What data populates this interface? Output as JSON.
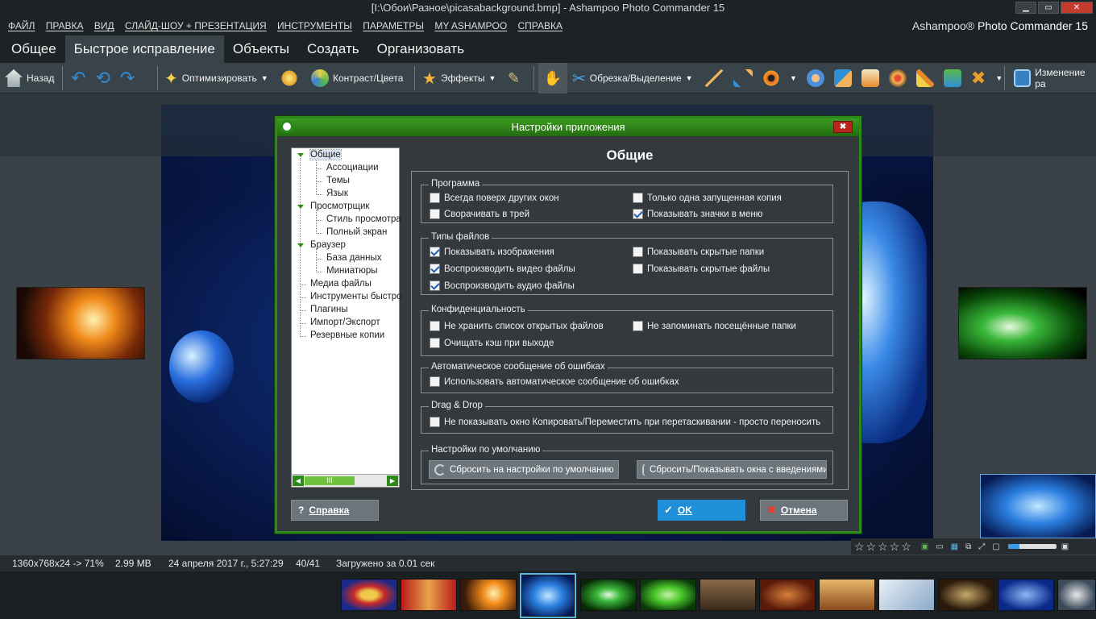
{
  "window": {
    "title": "[I:\\Обои\\Разное\\picasabackground.bmp] - Ashampoo Photo Commander 15"
  },
  "menu": [
    "ФАЙЛ",
    "ПРАВКА",
    "ВИД",
    "СЛАЙД-ШОУ + ПРЕЗЕНТАЦИЯ",
    "ИНСТРУМЕНТЫ",
    "ПАРАМЕТРЫ",
    "MY ASHAMPOO",
    "СПРАВКА"
  ],
  "brand": {
    "name": "Ashampoo®",
    "product": "Photo Commander 15"
  },
  "tabs": [
    "Общее",
    "Быстрое исправление",
    "Объекты",
    "Создать",
    "Организовать"
  ],
  "toolbar": {
    "back": "Назад",
    "optimize": "Оптимизировать",
    "contrast": "Контраст/Цвета",
    "effects": "Эффекты",
    "crop": "Обрезка/Выделение",
    "resize": "Изменение ра"
  },
  "status": {
    "dims": "1360x768x24 -> 71%",
    "size": "2.99 MB",
    "date": "24 апреля 2017 г., 5:27:29",
    "index": "40/41",
    "loaded": "Загружено за 0.01 сек",
    "rating_stars": "☆☆☆☆☆"
  },
  "dialog": {
    "title": "Настройки приложения",
    "close": "✖",
    "tree": [
      {
        "label": "Общие",
        "level": 0,
        "selected": true
      },
      {
        "label": "Ассоциации",
        "level": 1
      },
      {
        "label": "Темы",
        "level": 1
      },
      {
        "label": "Язык",
        "level": 1
      },
      {
        "label": "Просмотрщик",
        "level": 0
      },
      {
        "label": "Стиль просмотра",
        "level": 1
      },
      {
        "label": "Полный экран",
        "level": 1
      },
      {
        "label": "Браузер",
        "level": 0
      },
      {
        "label": "База данных",
        "level": 1
      },
      {
        "label": "Миниатюры",
        "level": 1
      },
      {
        "label": "Медиа файлы",
        "level": 0
      },
      {
        "label": "Инструменты быстро",
        "level": 0
      },
      {
        "label": "Плагины",
        "level": 0
      },
      {
        "label": "Импорт/Экспорт",
        "level": 0
      },
      {
        "label": "Резервные копии",
        "level": 0
      }
    ],
    "scroll_thumb": "III",
    "panel_title": "Общие",
    "groups": {
      "program": {
        "label": "Программа",
        "always_on_top": {
          "label": "Всегда поверх других окон",
          "checked": false
        },
        "single_instance": {
          "label": "Только одна запущенная копия",
          "checked": false
        },
        "minimize_tray": {
          "label": "Сворачивать в трей",
          "checked": false
        },
        "show_menu_icons": {
          "label": "Показывать значки в меню",
          "checked": true
        }
      },
      "filetypes": {
        "label": "Типы файлов",
        "show_images": {
          "label": "Показывать изображения",
          "checked": true
        },
        "show_hidden_folders": {
          "label": "Показывать скрытые папки",
          "checked": false
        },
        "play_video": {
          "label": "Воспроизводить видео файлы",
          "checked": true
        },
        "show_hidden_files": {
          "label": "Показывать скрытые файлы",
          "checked": false
        },
        "play_audio": {
          "label": "Воспроизводить аудио файлы",
          "checked": true
        }
      },
      "privacy": {
        "label": "Конфиденциальность",
        "no_recent": {
          "label": "Не хранить список открытых файлов",
          "checked": false
        },
        "no_visited": {
          "label": "Не запоминать посещённые папки",
          "checked": false
        },
        "clear_cache": {
          "label": "Очищать кэш при выходе",
          "checked": false
        }
      },
      "errors": {
        "label": "Автоматическое сообщение об ошибках",
        "auto_report": {
          "label": "Использовать автоматическое сообщение об ошибках",
          "checked": false
        }
      },
      "dragdrop": {
        "label": "Drag & Drop",
        "no_window": {
          "label": "Не показывать окно Копировать/Переместить при перетаскивании - просто переносить",
          "checked": false
        }
      },
      "defaults": {
        "label": "Настройки по умолчанию",
        "reset": "Сбросить на настройки по умолчанию",
        "reset_intro": "Сбросить/Показывать окна с введениями"
      }
    },
    "help": "Справка",
    "ok": "OK",
    "cancel": "Отмена"
  },
  "colors": {
    "accent_green": "#2c8a1a",
    "ok_blue": "#1e8fd8",
    "cancel_gray": "#6b757b",
    "app_dark": "#1d2225"
  }
}
